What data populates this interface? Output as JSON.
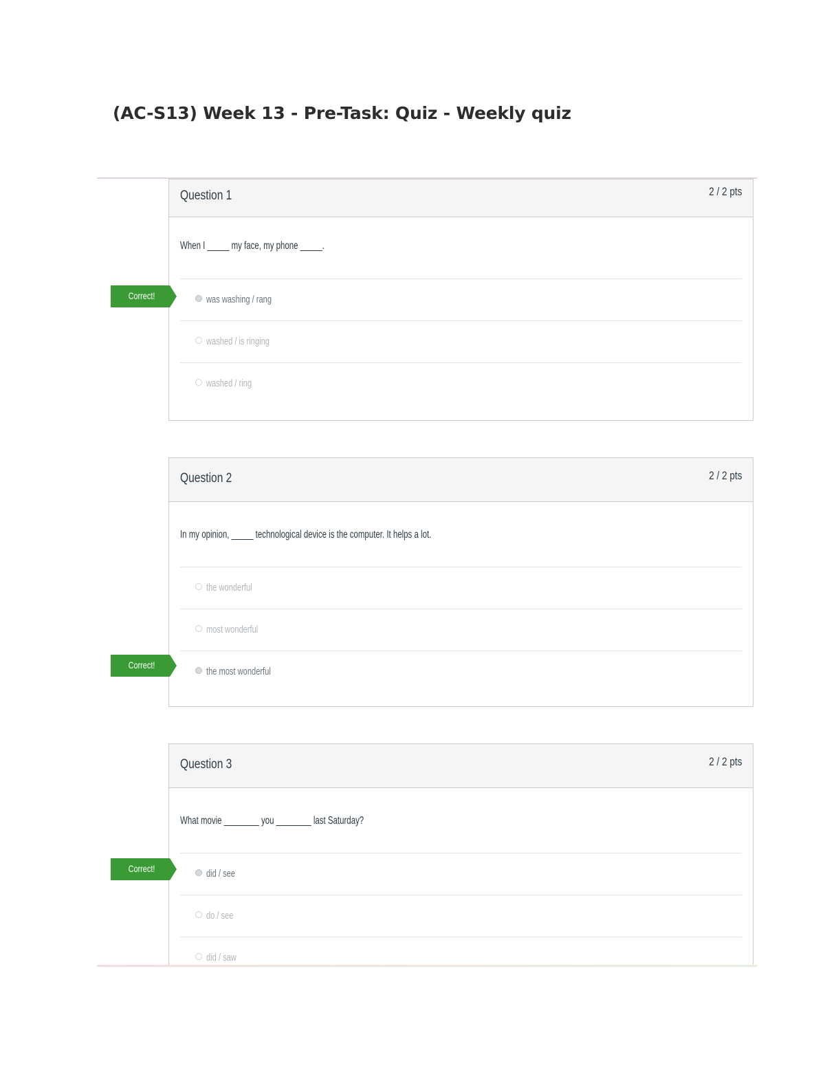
{
  "page": {
    "title": "(AC-S13) Week 13 - Pre-Task: Quiz - Weekly quiz"
  },
  "colors": {
    "correct_tag": "#3a9a34",
    "header_bg": "#f5f5f5",
    "border": "#c7cdd1"
  },
  "correct_label": "Correct!",
  "questions": [
    {
      "title": "Question 1",
      "points": "2 / 2 pts",
      "text": "When I _____ my face, my phone _____.",
      "answers": [
        {
          "label": "was washing / rang",
          "selected": true
        },
        {
          "label": "washed / is ringing",
          "selected": false
        },
        {
          "label": "washed / ring",
          "selected": false
        }
      ]
    },
    {
      "title": "Question 2",
      "points": "2 / 2 pts",
      "text": "In my opinion, _____ technological device is the computer. It helps a lot.",
      "answers": [
        {
          "label": "the wonderful",
          "selected": false
        },
        {
          "label": "most wonderful",
          "selected": false
        },
        {
          "label": "the most wonderful",
          "selected": true
        }
      ]
    },
    {
      "title": "Question 3",
      "points": "2 / 2 pts",
      "text": "What movie ________ you ________ last Saturday?",
      "answers": [
        {
          "label": "did / see",
          "selected": true
        },
        {
          "label": "do / see",
          "selected": false
        },
        {
          "label": "did / saw",
          "selected": false
        }
      ]
    }
  ]
}
